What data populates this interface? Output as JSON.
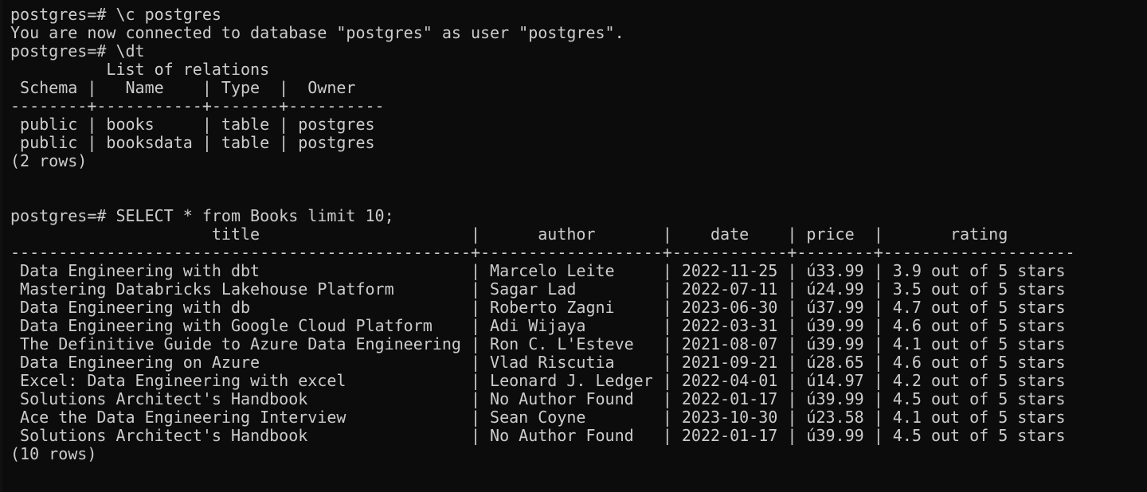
{
  "terminal": {
    "lines": [
      "postgres=# \\c postgres",
      "You are now connected to database \"postgres\" as user \"postgres\".",
      "postgres=# \\dt",
      "          List of relations",
      " Schema |   Name    | Type  |  Owner",
      "--------+-----------+-------+----------",
      " public | books     | table | postgres",
      " public | booksdata | table | postgres",
      "(2 rows)",
      "",
      "",
      "postgres=# SELECT * from Books limit 10;",
      "                     title                      |      author       |    date    | price  |       rating",
      "------------------------------------------------+-------------------+------------+--------+--------------------",
      " Data Engineering with dbt                      | Marcelo Leite     | 2022-11-25 | ú33.99 | 3.9 out of 5 stars",
      " Mastering Databricks Lakehouse Platform        | Sagar Lad         | 2022-07-11 | ú24.99 | 3.5 out of 5 stars",
      " Data Engineering with db                       | Roberto Zagni     | 2023-06-30 | ú37.99 | 4.7 out of 5 stars",
      " Data Engineering with Google Cloud Platform    | Adi Wijaya        | 2022-03-31 | ú39.99 | 4.6 out of 5 stars",
      " The Definitive Guide to Azure Data Engineering | Ron C. L'Esteve   | 2021-08-07 | ú39.99 | 4.1 out of 5 stars",
      " Data Engineering on Azure                      | Vlad Riscutia     | 2021-09-21 | ú28.65 | 4.6 out of 5 stars",
      " Excel: Data Engineering with excel             | Leonard J. Ledger | 2022-04-01 | ú14.97 | 4.2 out of 5 stars",
      " Solutions Architect's Handbook                 | No Author Found   | 2022-01-17 | ú39.99 | 4.5 out of 5 stars",
      " Ace the Data Engineering Interview             | Sean Coyne        | 2023-10-30 | ú23.58 | 4.1 out of 5 stars",
      " Solutions Architect's Handbook                 | No Author Found   | 2022-01-17 | ú39.99 | 4.5 out of 5 stars",
      "(10 rows)"
    ]
  }
}
